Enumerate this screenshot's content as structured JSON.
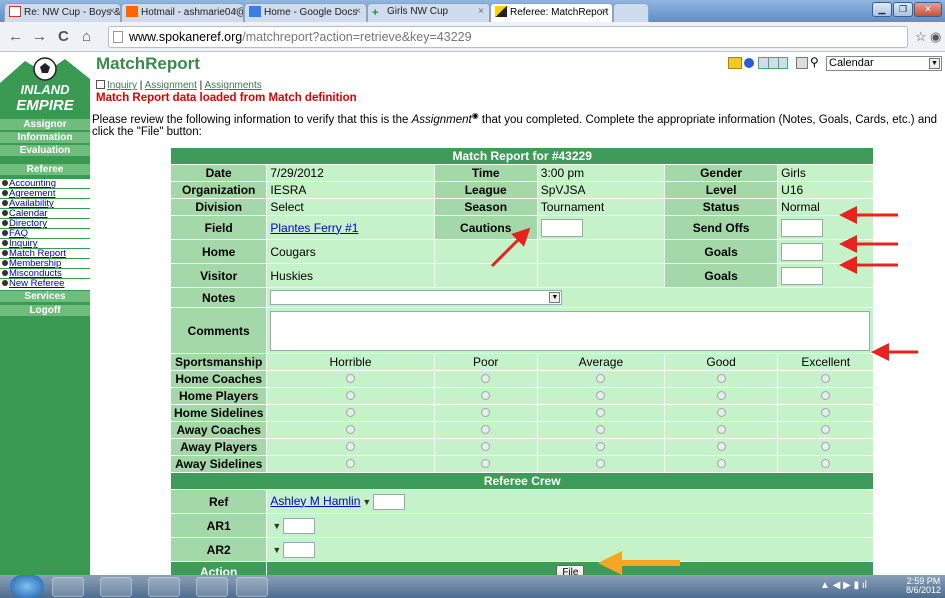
{
  "browser": {
    "tabs": [
      {
        "label": "Re: NW Cup - Boys & Girls",
        "icon": "gmail-icon",
        "active": false
      },
      {
        "label": "Hotmail - ashmarie04@hot",
        "icon": "hotmail-icon",
        "active": false
      },
      {
        "label": "Home - Google Docs",
        "icon": "docs-icon",
        "active": false
      },
      {
        "label": "Girls NW Cup",
        "icon": "plus-icon",
        "active": false
      },
      {
        "label": "Referee: MatchReport",
        "icon": "referee-icon",
        "active": true
      }
    ],
    "url_domain": "www.spokaneref.org",
    "url_path": "/matchreport?action=retrieve&key=43229"
  },
  "sidebar": {
    "logo_text": "INLAND EMPIRE",
    "sections": [
      "Assignor",
      "Information",
      "Evaluation",
      "Referee"
    ],
    "links": [
      "Accounting",
      "Agreement",
      "Availability",
      "Calendar",
      "Directory",
      "FAQ",
      "Inquiry",
      "Match Report",
      "Membership",
      "Misconducts",
      "New Referee"
    ],
    "bottom_sections": [
      "Services",
      "Logoff"
    ]
  },
  "header": {
    "title": "MatchReport",
    "calendar_select": "Calendar"
  },
  "breadcrumb": {
    "inquiry": "Inquiry",
    "sep": " | ",
    "assignment": "Assignment",
    "assignments": "Assignments"
  },
  "loaded_msg": "Match Report data loaded from Match definition",
  "instructions_a": "Please review the following information to verify that this is the ",
  "instructions_em": "Assignment",
  "instructions_b": " that you completed. Complete the appropriate information (Notes, Goals, Cards, etc.) and click the \"File\" button:",
  "report": {
    "heading": "Match Report for #43229",
    "labels": {
      "date": "Date",
      "time": "Time",
      "gender": "Gender",
      "organization": "Organization",
      "league": "League",
      "level": "Level",
      "division": "Division",
      "season": "Season",
      "status": "Status",
      "field": "Field",
      "cautions": "Cautions",
      "send_offs": "Send Offs",
      "home": "Home",
      "goals_home": "Goals",
      "visitor": "Visitor",
      "goals_visitor": "Goals",
      "notes": "Notes",
      "comments": "Comments"
    },
    "values": {
      "date": "7/29/2012",
      "time": "3:00 pm",
      "gender": "Girls",
      "organization": "IESRA",
      "league": "SpVJSA",
      "level": "U16",
      "division": "Select",
      "season": "Tournament",
      "status": "Normal",
      "field": "Plantes Ferry #1",
      "home": "Cougars",
      "visitor": "Huskies"
    },
    "sportsmanship": {
      "label": "Sportsmanship",
      "ratings": [
        "Horrible",
        "Poor",
        "Average",
        "Good",
        "Excellent"
      ],
      "rows": [
        "Home Coaches",
        "Home Players",
        "Home Sidelines",
        "Away Coaches",
        "Away Players",
        "Away Sidelines"
      ]
    },
    "crew": {
      "heading": "Referee Crew",
      "ref_label": "Ref",
      "ref_name": "Ashley M Hamlin",
      "ar1_label": "AR1",
      "ar2_label": "AR2"
    },
    "action_label": "Action",
    "file_button": "File"
  },
  "taskbar": {
    "time": "2:59 PM",
    "date": "8/6/2012"
  },
  "colors": {
    "arrow_red": "#e8221e",
    "arrow_orange": "#f5a623",
    "header_green": "#3f9b59"
  }
}
